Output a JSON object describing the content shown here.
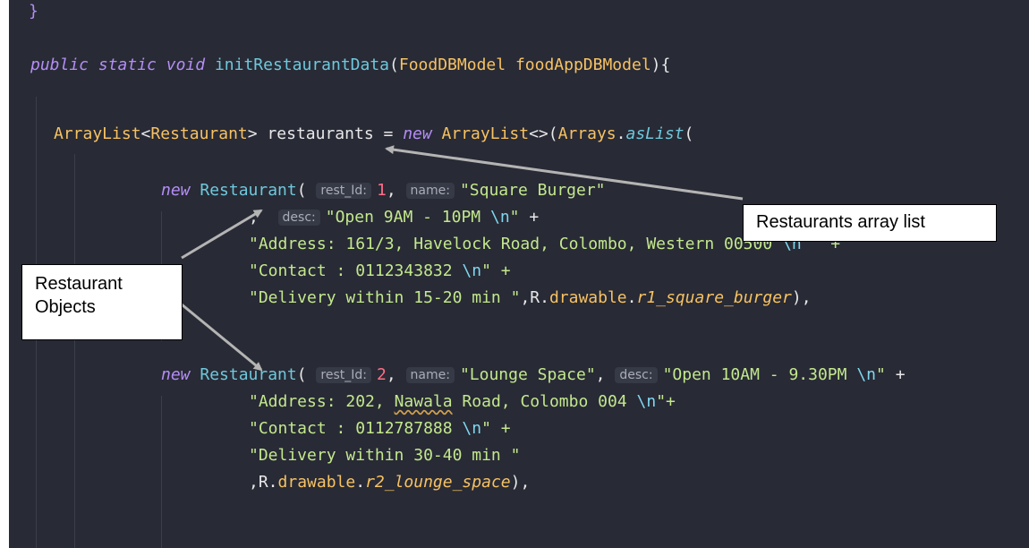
{
  "editor": {
    "brace": "}",
    "l1": {
      "kw1": "public",
      "kw2": "static",
      "kw3": "void",
      "method": "initRestaurantData",
      "open": "(",
      "type": "FoodDBModel",
      "param": "foodAppDBModel",
      "close": "){"
    },
    "l2": {
      "type1": "ArrayList",
      "lt": "<",
      "type2": "Restaurant",
      "gt": ">",
      "var": "restaurants",
      "eq": " = ",
      "kw": "new",
      "type3": "ArrayList",
      "diamond": "<>(",
      "cls": "Arrays",
      "dot": ".",
      "method": "asList",
      "paren": "("
    },
    "r1": {
      "kw": "new",
      "cls": "Restaurant",
      "open": "(",
      "h_id": "rest_Id:",
      "id": "1",
      "comma": ",",
      "h_name": "name:",
      "name": "\"Square Burger\"",
      "sep": ",",
      "h_desc": "desc:",
      "desc1": "\"Open 9AM - 10PM ",
      "esc": "\\n",
      "q": "\"",
      "plus": " +",
      "line2a": "\"Address: 161/3, Havelock Road, Colombo, Western 00500 ",
      "line2b": " \" +",
      "line3a": "\"Contact : 0112343832 ",
      "line3b": "\" +",
      "line4a": "\"Delivery within 15-20 min \"",
      "line4b": ",R.",
      "line4c": "drawable",
      "line4d": ".",
      "line4e": "r1_square_burger",
      "line4f": "),"
    },
    "r2": {
      "kw": "new",
      "cls": "Restaurant",
      "open": "(",
      "h_id": "rest_Id:",
      "id": "2",
      "comma": ",",
      "h_name": "name:",
      "name": "\"Lounge Space\"",
      "comma2": ",",
      "h_desc": "desc:",
      "desc1": "\"Open 10AM - 9.30PM ",
      "esc": "\\n",
      "q": "\"",
      "plus": " +",
      "line2a": "\"Address: 202, ",
      "line2word": "Nawala",
      "line2b": " Road, Colombo 004 ",
      "line2c": "\"+",
      "line3a": "\"Contact : 0112787888 ",
      "line3b": "\" +",
      "line4a": "\"Delivery within 30-40 min \"",
      "line5a": ",R.",
      "line5b": "drawable",
      "line5c": ".",
      "line5d": "r2_lounge_space",
      "line5e": "),"
    }
  },
  "annotations": {
    "array_list_label": "Restaurants array list",
    "objects_label_1": "Restaurant",
    "objects_label_2": "Objects",
    "arrow_color": "#b4b4b4"
  }
}
